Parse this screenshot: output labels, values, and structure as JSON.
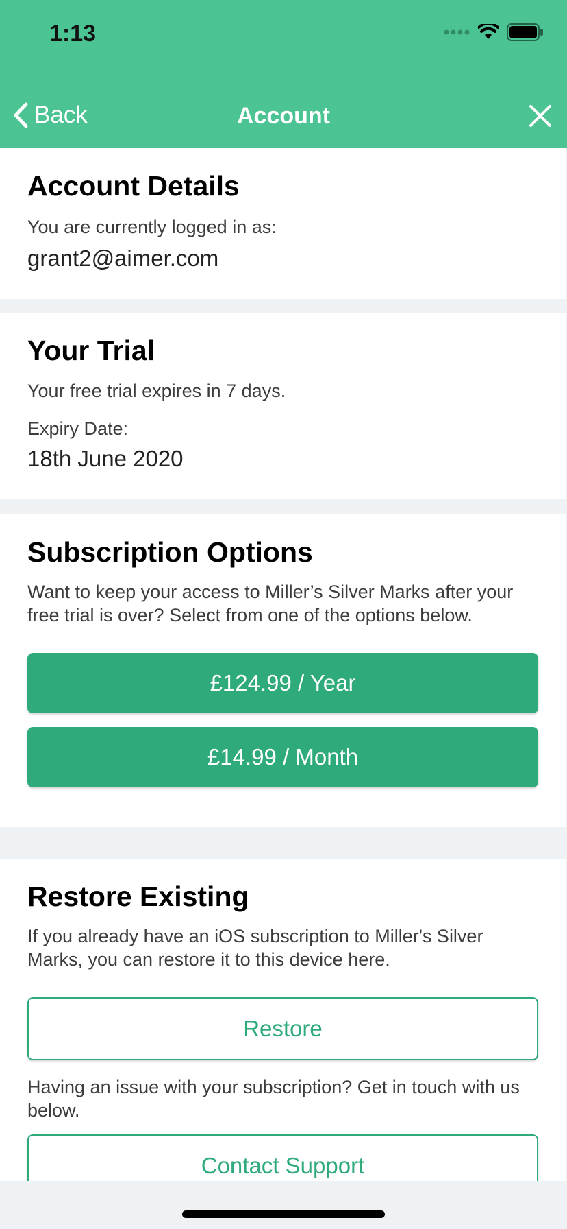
{
  "status_bar": {
    "time": "1:13"
  },
  "nav": {
    "back_label": "Back",
    "title": "Account"
  },
  "account": {
    "title": "Account Details",
    "logged_in_label": "You are currently logged in as:",
    "email": "grant2@aimer.com"
  },
  "trial": {
    "title": "Your Trial",
    "expires_text": "Your free trial expires in 7 days.",
    "expiry_label": "Expiry Date:",
    "expiry_date": "18th June 2020"
  },
  "subscription": {
    "title": "Subscription Options",
    "description": "Want to keep your access to Miller’s Silver Marks after your free trial is over? Select from one of the options below.",
    "year_button": "£124.99 / Year",
    "month_button": "£14.99 / Month"
  },
  "restore": {
    "title": "Restore Existing",
    "description": "If you already have an iOS subscription to Miller's Silver Marks, you can restore it to this device here.",
    "restore_button": "Restore",
    "support_text": "Having an issue with your subscription? Get in touch with us below.",
    "support_button": "Contact Support"
  },
  "colors": {
    "header": "#4bc393",
    "button": "#2eaa7b",
    "background": "#eef2f5"
  }
}
